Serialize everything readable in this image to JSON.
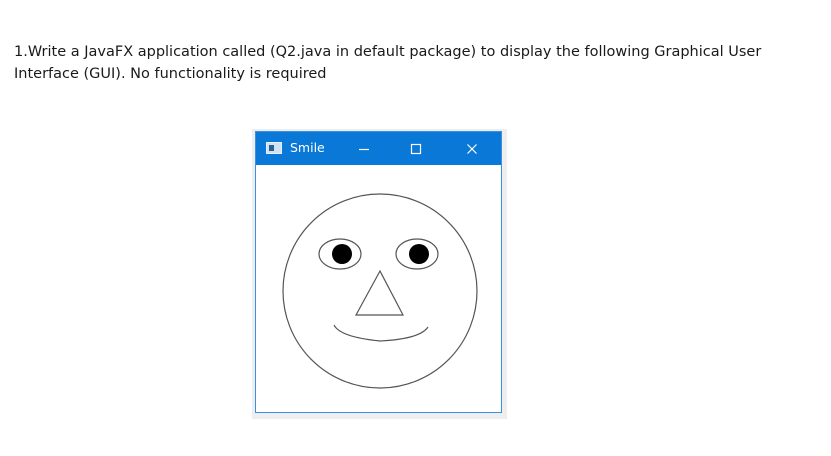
{
  "question": {
    "line1": "1.Write a JavaFX application called (Q2.java in default package) to display the following Graphical User",
    "line2": "Interface (GUI). No functionality is required"
  },
  "window": {
    "title": "Smile",
    "titlebar_color": "#0a78d7",
    "icons": {
      "app": "window-app-icon",
      "minimize": "minimize-icon",
      "maximize": "maximize-icon",
      "close": "close-icon"
    }
  },
  "drawing": {
    "subject": "smiley face",
    "stroke_color": "#555555",
    "eye_fill": "#000000"
  }
}
